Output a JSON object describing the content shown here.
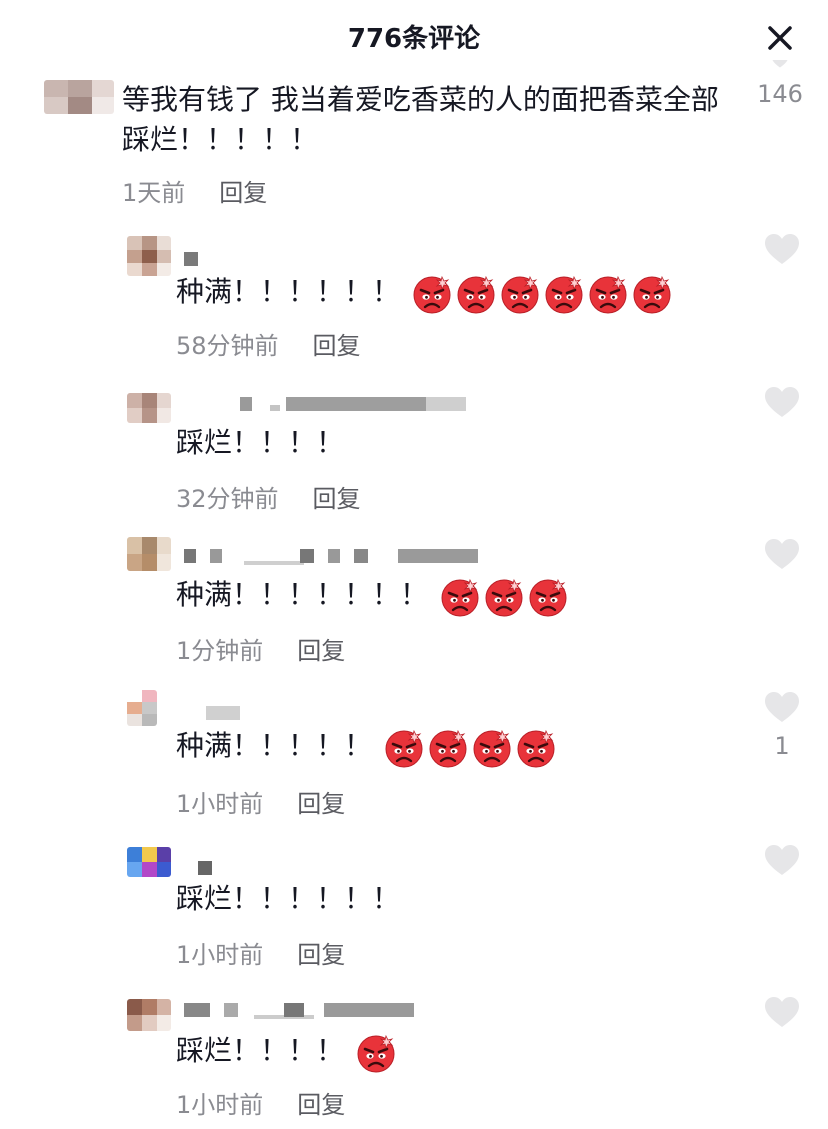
{
  "header": {
    "title": "776条评论"
  },
  "top_comment": {
    "text": "等我有钱了 我当着爱吃香菜的人的面把香菜全部踩烂！！！！！",
    "time": "1天前",
    "reply_label": "回复",
    "like_count": "146"
  },
  "replies": [
    {
      "text": "种满！！！！！！",
      "emoji_count": 6,
      "time": "58分钟前",
      "reply_label": "回复",
      "like_count": ""
    },
    {
      "text": "踩烂！！！！",
      "emoji_count": 0,
      "time": "32分钟前",
      "reply_label": "回复",
      "like_count": ""
    },
    {
      "text": "种满！！！！！！！",
      "emoji_count": 3,
      "time": "1分钟前",
      "reply_label": "回复",
      "like_count": ""
    },
    {
      "text": "种满！！！！！",
      "emoji_count": 4,
      "time": "1小时前",
      "reply_label": "回复",
      "like_count": "1"
    },
    {
      "text": "踩烂！！！！！！",
      "emoji_count": 0,
      "time": "1小时前",
      "reply_label": "回复",
      "like_count": ""
    },
    {
      "text": "踩烂！！！！",
      "emoji_count": 1,
      "time": "1小时前",
      "reply_label": "回复",
      "like_count": ""
    }
  ],
  "icons": {
    "close": "close-icon",
    "like": "heart-icon",
    "emoji": "angry-face-emoji"
  },
  "colors": {
    "text": "#161823",
    "meta": "#8a8b91",
    "heart": "#e6e6e8",
    "emoji_red": "#e8333a"
  }
}
